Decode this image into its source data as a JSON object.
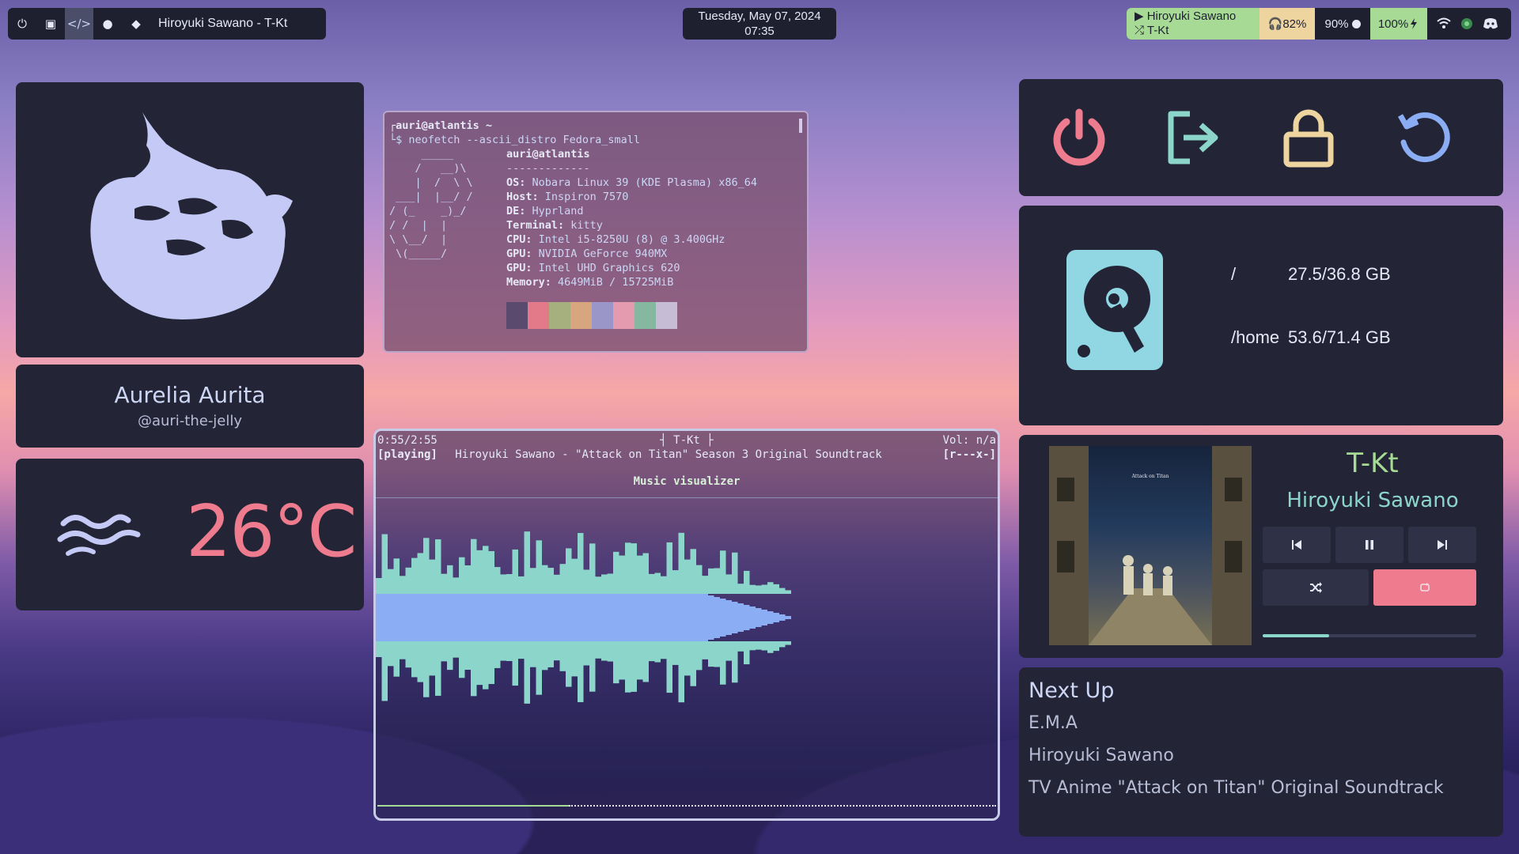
{
  "topbar": {
    "workspaces": [
      "⏻",
      "▣",
      "</>",
      "●",
      "◆"
    ],
    "window_title": "Hiroyuki Sawano - T-Kt",
    "date": "Tuesday, May 07, 2024",
    "time": "07:35",
    "media_artist": "▶ Hiroyuki Sawano",
    "media_track": "⤮ T-Kt",
    "headphones": "🎧82%",
    "brightness": "90%",
    "battery": "100%"
  },
  "profile": {
    "name": "Aurelia Aurita",
    "handle": "@auri-the-jelly"
  },
  "weather": {
    "temperature": "26°C"
  },
  "terminal": {
    "prompt_user": "┌auri@atlantis ~",
    "command": "└$ neofetch --ascii_distro Fedora_small",
    "ascii_art": "     _____\n    /   __)\\\n    |  /  \\ \\\n ___|  |__/ /\n/ (_    _)_/\n/ /  |  |\n\\ \\__/  |\n \\(_____/",
    "userhost": "auri@atlantis",
    "divider": "-------------",
    "info": [
      {
        "key": "OS:",
        "value": " Nobara Linux 39 (KDE Plasma) x86_64"
      },
      {
        "key": "Host:",
        "value": " Inspiron 7570"
      },
      {
        "key": "DE:",
        "value": " Hyprland"
      },
      {
        "key": "Terminal:",
        "value": " kitty"
      },
      {
        "key": "CPU:",
        "value": " Intel i5-8250U (8) @ 3.400GHz"
      },
      {
        "key": "GPU:",
        "value": " NVIDIA GeForce 940MX"
      },
      {
        "key": "GPU:",
        "value": " Intel UHD Graphics 620"
      },
      {
        "key": "Memory:",
        "value": " 4649MiB / 15725MiB"
      }
    ],
    "swatches": [
      "#5a4a6e",
      "#e27a8a",
      "#a6b07e",
      "#d8a67e",
      "#9b96c8",
      "#e49aaf",
      "#86b8a0",
      "#c7bcd6"
    ]
  },
  "visualizer": {
    "position": "0:55/2:55",
    "title": "┤ T-Kt ├",
    "volume": "Vol: n/a",
    "state": "[playing]",
    "now_playing": "Hiroyuki Sawano - \"Attack on Titan\" Season 3 Original Soundtrack",
    "flags": "[r---x-]",
    "header": "Music visualizer",
    "progress": 0.31
  },
  "disk": {
    "root_label": "/",
    "root_usage": "27.5/36.8 GB",
    "home_label": "/home",
    "home_usage": "53.6/71.4 GB"
  },
  "player": {
    "track": "T-Kt",
    "artist": "Hiroyuki Sawano",
    "progress": 0.31
  },
  "next_up": {
    "heading": "Next Up",
    "track": "E.M.A",
    "artist": "Hiroyuki Sawano",
    "album": "TV Anime \"Attack on Titan\" Original Soundtrack"
  },
  "colors": {
    "accent_red": "#ee7b8e",
    "accent_green": "#a6da95",
    "accent_yellow": "#eed49f",
    "accent_blue": "#8aadf4",
    "accent_teal": "#8bd5ca",
    "panel_bg": "#232536"
  }
}
